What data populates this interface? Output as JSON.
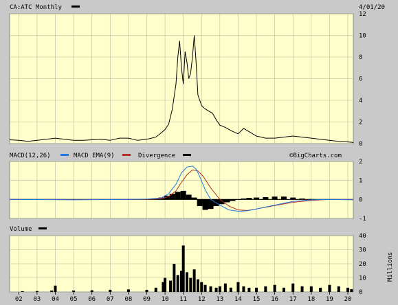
{
  "header": {
    "symbol_label": "CA:ATC Monthly",
    "date": "4/01/20"
  },
  "macd_legend": {
    "macd": "MACD(12,26)",
    "ema": "MACD EMA(9)",
    "divergence": "Divergence",
    "copyright": "©BigCharts.com"
  },
  "volume_legend": {
    "label": "Volume",
    "units": "Millions"
  },
  "colors": {
    "panel_bg": "#ffffcc",
    "frame_bg": "#c9c9c9",
    "macd_line": "#1f78e6",
    "ema_line": "#b23020",
    "bars": "#000000"
  },
  "chart_data": [
    {
      "type": "line",
      "title": "CA:ATC Monthly",
      "x_tick_labels": [
        "02",
        "03",
        "04",
        "05",
        "06",
        "07",
        "08",
        "09",
        "10",
        "11",
        "12",
        "13",
        "14",
        "15",
        "16",
        "17",
        "18",
        "19",
        "20"
      ],
      "x_range": [
        2001.5,
        2020.3
      ],
      "ylim": [
        0,
        12
      ],
      "y_ticks": [
        0,
        2,
        4,
        6,
        8,
        10,
        12
      ],
      "grid": true,
      "series": [
        {
          "x": [
            2001.5,
            2002.0,
            2002.5,
            2003.0,
            2003.5,
            2004.0,
            2004.5,
            2005.0,
            2005.5,
            2006.0,
            2006.5,
            2007.0,
            2007.5,
            2008.0,
            2008.5,
            2009.0,
            2009.5,
            2009.8,
            2010.0,
            2010.2,
            2010.4,
            2010.6,
            2010.7,
            2010.8,
            2010.9,
            2011.0,
            2011.1,
            2011.2,
            2011.3,
            2011.4,
            2011.5,
            2011.6,
            2011.7,
            2011.8,
            2011.9,
            2012.0,
            2012.2,
            2012.4,
            2012.6,
            2012.8,
            2013.0,
            2013.3,
            2013.6,
            2014.0,
            2014.3,
            2014.6,
            2015.0,
            2015.5,
            2016.0,
            2016.5,
            2017.0,
            2017.5,
            2018.0,
            2018.5,
            2019.0,
            2019.5,
            2020.0,
            2020.3
          ],
          "values": [
            0.35,
            0.3,
            0.2,
            0.3,
            0.4,
            0.5,
            0.4,
            0.3,
            0.3,
            0.35,
            0.4,
            0.3,
            0.5,
            0.5,
            0.3,
            0.4,
            0.6,
            1.0,
            1.3,
            1.8,
            3.2,
            5.5,
            8.0,
            9.5,
            7.0,
            5.5,
            8.5,
            7.5,
            6.0,
            6.5,
            8.0,
            10.0,
            7.5,
            4.5,
            4.0,
            3.5,
            3.2,
            3.0,
            2.8,
            2.2,
            1.7,
            1.5,
            1.2,
            0.9,
            1.4,
            1.1,
            0.7,
            0.5,
            0.5,
            0.6,
            0.7,
            0.6,
            0.5,
            0.4,
            0.3,
            0.2,
            0.15,
            0.1
          ]
        }
      ]
    },
    {
      "type": "line",
      "title": "MACD(12,26)",
      "ylim": [
        -1,
        2
      ],
      "y_ticks": [
        -1,
        0,
        1,
        2
      ],
      "series": [
        {
          "name": "MACD(12,26)",
          "x": [
            2001.5,
            2005,
            2008,
            2009,
            2009.8,
            2010.2,
            2010.6,
            2010.9,
            2011.2,
            2011.5,
            2011.7,
            2011.9,
            2012.2,
            2012.5,
            2013,
            2013.5,
            2014,
            2014.5,
            2015,
            2016,
            2017,
            2018,
            2019,
            2020.3
          ],
          "values": [
            0,
            -0.02,
            0,
            0.02,
            0.08,
            0.3,
            0.8,
            1.4,
            1.7,
            1.75,
            1.6,
            1.2,
            0.5,
            0,
            -0.3,
            -0.55,
            -0.62,
            -0.6,
            -0.5,
            -0.3,
            -0.1,
            -0.02,
            0,
            -0.02
          ]
        },
        {
          "name": "MACD EMA(9)",
          "x": [
            2001.5,
            2005,
            2008,
            2009,
            2009.8,
            2010.2,
            2010.6,
            2010.9,
            2011.2,
            2011.5,
            2011.8,
            2012.1,
            2012.5,
            2013,
            2013.5,
            2014,
            2014.5,
            2015,
            2016,
            2017,
            2018,
            2019,
            2020.3
          ],
          "values": [
            0,
            -0.01,
            0,
            0.01,
            0.04,
            0.15,
            0.45,
            0.9,
            1.3,
            1.55,
            1.5,
            1.2,
            0.6,
            0,
            -0.35,
            -0.55,
            -0.58,
            -0.5,
            -0.32,
            -0.15,
            -0.05,
            0,
            -0.01
          ]
        },
        {
          "name": "Divergence",
          "type": "bar",
          "x": [
            2009.5,
            2009.8,
            2010.1,
            2010.4,
            2010.7,
            2011.0,
            2011.3,
            2011.6,
            2011.9,
            2012.2,
            2012.5,
            2012.8,
            2013.1,
            2013.4,
            2013.7,
            2014.0,
            2014.3,
            2014.6,
            2015.0,
            2015.5,
            2016.0,
            2016.5,
            2017.0,
            2017.5,
            2018.0
          ],
          "values": [
            0.03,
            0.1,
            0.2,
            0.3,
            0.4,
            0.45,
            0.25,
            0.1,
            -0.35,
            -0.55,
            -0.5,
            -0.35,
            -0.25,
            -0.15,
            -0.08,
            -0.02,
            0.05,
            0.08,
            0.1,
            0.12,
            0.15,
            0.15,
            0.1,
            0.05,
            0.02
          ]
        }
      ]
    },
    {
      "type": "bar",
      "title": "Volume",
      "ylabel": "Millions",
      "ylim": [
        0,
        40
      ],
      "y_ticks": [
        0,
        10,
        20,
        30,
        40
      ],
      "x": [
        2002.2,
        2003.0,
        2003.8,
        2004.0,
        2005.0,
        2006.0,
        2007.0,
        2008.0,
        2009.0,
        2009.5,
        2009.9,
        2010.0,
        2010.3,
        2010.5,
        2010.7,
        2010.9,
        2011.0,
        2011.2,
        2011.4,
        2011.6,
        2011.8,
        2012.0,
        2012.2,
        2012.5,
        2012.8,
        2013.0,
        2013.3,
        2013.6,
        2014.0,
        2014.3,
        2014.6,
        2015.0,
        2015.5,
        2016.0,
        2016.5,
        2017.0,
        2017.5,
        2018.0,
        2018.5,
        2019.0,
        2019.5,
        2020.0,
        2020.2
      ],
      "values": [
        0.5,
        0.6,
        1.0,
        4.5,
        1.0,
        1.2,
        1.5,
        1.8,
        1.5,
        3,
        7,
        10,
        8,
        20,
        12,
        15,
        33,
        14,
        10,
        16,
        9,
        7,
        5,
        4,
        3,
        4,
        6,
        3,
        7,
        4,
        3,
        3,
        4,
        5,
        3,
        6,
        4,
        4,
        3,
        5,
        4,
        3,
        2
      ]
    }
  ]
}
